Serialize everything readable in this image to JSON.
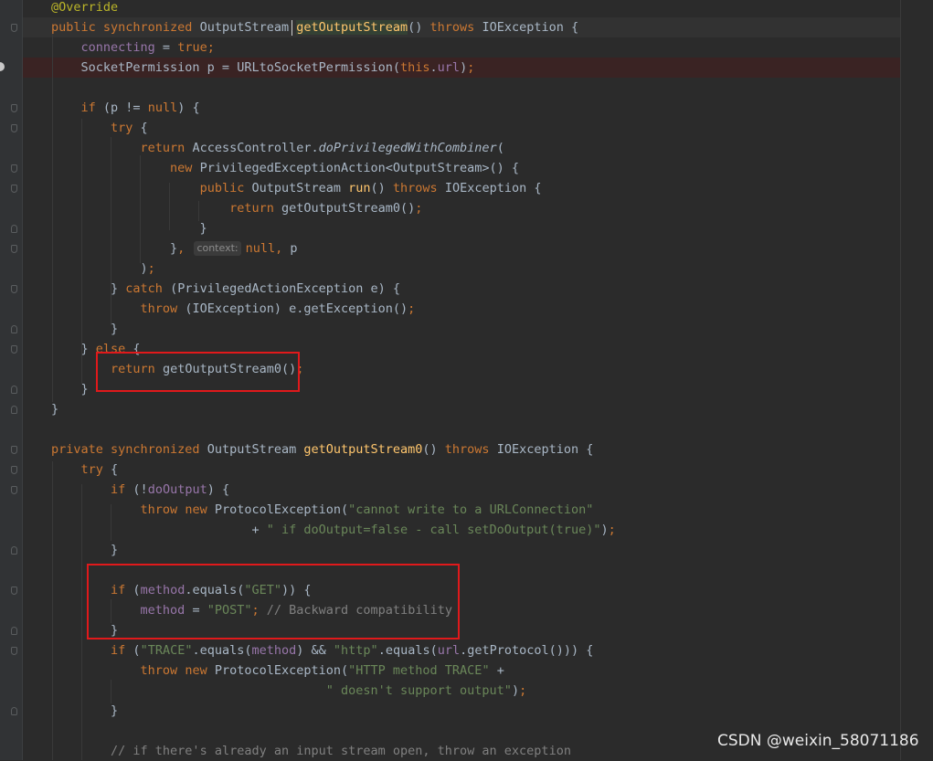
{
  "editor": {
    "theme_colors": {
      "background": "#2b2b2b",
      "keyword": "#cc7832",
      "annotation": "#bbb529",
      "field": "#9876aa",
      "string": "#6a8759",
      "comment": "#808080",
      "method_declaration": "#ffc66d",
      "highlight_box": "#e0191b"
    },
    "lines": [
      {
        "tokens": [
          {
            "t": "ann",
            "v": "@Override"
          }
        ]
      },
      {
        "tokens": [
          {
            "t": "kw",
            "v": "public synchronized "
          },
          {
            "t": "plain",
            "v": "OutputStream "
          },
          {
            "t": "sel",
            "v": "getOutputStream"
          },
          {
            "t": "plain",
            "v": "() "
          },
          {
            "t": "kw",
            "v": "throws "
          },
          {
            "t": "plain",
            "v": "IOException {"
          }
        ]
      },
      {
        "tokens": [
          {
            "t": "plain",
            "v": "    "
          },
          {
            "t": "field",
            "v": "connecting"
          },
          {
            "t": "plain",
            "v": " = "
          },
          {
            "t": "kw",
            "v": "true;"
          }
        ]
      },
      {
        "tokens": [
          {
            "t": "plain",
            "v": "    SocketPermission p = URLtoSocketPermission("
          },
          {
            "t": "kw",
            "v": "this"
          },
          {
            "t": "plain",
            "v": "."
          },
          {
            "t": "field",
            "v": "url"
          },
          {
            "t": "plain",
            "v": ")"
          },
          {
            "t": "kw",
            "v": ";"
          }
        ]
      },
      {
        "tokens": []
      },
      {
        "tokens": [
          {
            "t": "plain",
            "v": "    "
          },
          {
            "t": "kw",
            "v": "if "
          },
          {
            "t": "plain",
            "v": "(p != "
          },
          {
            "t": "kw",
            "v": "null"
          },
          {
            "t": "plain",
            "v": ") {"
          }
        ]
      },
      {
        "tokens": [
          {
            "t": "plain",
            "v": "        "
          },
          {
            "t": "kw",
            "v": "try "
          },
          {
            "t": "plain",
            "v": "{"
          }
        ]
      },
      {
        "tokens": [
          {
            "t": "plain",
            "v": "            "
          },
          {
            "t": "kw",
            "v": "return "
          },
          {
            "t": "plain",
            "v": "AccessController."
          },
          {
            "t": "ital",
            "v": "doPrivilegedWithCombiner"
          },
          {
            "t": "plain",
            "v": "("
          }
        ]
      },
      {
        "tokens": [
          {
            "t": "plain",
            "v": "                "
          },
          {
            "t": "kw",
            "v": "new "
          },
          {
            "t": "plain",
            "v": "PrivilegedExceptionAction<OutputStream>() {"
          }
        ]
      },
      {
        "tokens": [
          {
            "t": "plain",
            "v": "                    "
          },
          {
            "t": "kw",
            "v": "public "
          },
          {
            "t": "plain",
            "v": "OutputStream "
          },
          {
            "t": "method",
            "v": "run"
          },
          {
            "t": "plain",
            "v": "() "
          },
          {
            "t": "kw",
            "v": "throws "
          },
          {
            "t": "plain",
            "v": "IOException {"
          }
        ]
      },
      {
        "tokens": [
          {
            "t": "plain",
            "v": "                        "
          },
          {
            "t": "kw",
            "v": "return "
          },
          {
            "t": "plain",
            "v": "getOutputStream0()"
          },
          {
            "t": "kw",
            "v": ";"
          }
        ]
      },
      {
        "tokens": [
          {
            "t": "plain",
            "v": "                    }"
          }
        ]
      },
      {
        "tokens": [
          {
            "t": "plain",
            "v": "                }"
          },
          {
            "t": "kw",
            "v": ", "
          },
          {
            "t": "hint",
            "v": "context:"
          },
          {
            "t": "kw",
            "v": "null, "
          },
          {
            "t": "plain",
            "v": "p"
          }
        ]
      },
      {
        "tokens": [
          {
            "t": "plain",
            "v": "            )"
          },
          {
            "t": "kw",
            "v": ";"
          }
        ]
      },
      {
        "tokens": [
          {
            "t": "plain",
            "v": "        } "
          },
          {
            "t": "kw",
            "v": "catch "
          },
          {
            "t": "plain",
            "v": "(PrivilegedActionException e) {"
          }
        ]
      },
      {
        "tokens": [
          {
            "t": "plain",
            "v": "            "
          },
          {
            "t": "kw",
            "v": "throw "
          },
          {
            "t": "plain",
            "v": "(IOException) e.getException()"
          },
          {
            "t": "kw",
            "v": ";"
          }
        ]
      },
      {
        "tokens": [
          {
            "t": "plain",
            "v": "        }"
          }
        ]
      },
      {
        "tokens": [
          {
            "t": "plain",
            "v": "    } "
          },
          {
            "t": "kw",
            "v": "else "
          },
          {
            "t": "plain",
            "v": "{"
          }
        ]
      },
      {
        "tokens": [
          {
            "t": "plain",
            "v": "        "
          },
          {
            "t": "kw",
            "v": "return "
          },
          {
            "t": "plain",
            "v": "getOutputStream0()"
          },
          {
            "t": "kw",
            "v": ";"
          }
        ]
      },
      {
        "tokens": [
          {
            "t": "plain",
            "v": "    }"
          }
        ]
      },
      {
        "tokens": [
          {
            "t": "plain",
            "v": "}"
          }
        ]
      },
      {
        "tokens": []
      },
      {
        "tokens": [
          {
            "t": "kw",
            "v": "private synchronized "
          },
          {
            "t": "plain",
            "v": "OutputStream "
          },
          {
            "t": "method",
            "v": "getOutputStream0"
          },
          {
            "t": "plain",
            "v": "() "
          },
          {
            "t": "kw",
            "v": "throws "
          },
          {
            "t": "plain",
            "v": "IOException {"
          }
        ]
      },
      {
        "tokens": [
          {
            "t": "plain",
            "v": "    "
          },
          {
            "t": "kw",
            "v": "try "
          },
          {
            "t": "plain",
            "v": "{"
          }
        ]
      },
      {
        "tokens": [
          {
            "t": "plain",
            "v": "        "
          },
          {
            "t": "kw",
            "v": "if "
          },
          {
            "t": "plain",
            "v": "(!"
          },
          {
            "t": "field",
            "v": "doOutput"
          },
          {
            "t": "plain",
            "v": ") {"
          }
        ]
      },
      {
        "tokens": [
          {
            "t": "plain",
            "v": "            "
          },
          {
            "t": "kw",
            "v": "throw new "
          },
          {
            "t": "plain",
            "v": "ProtocolException("
          },
          {
            "t": "str",
            "v": "\"cannot write to a URLConnection\""
          }
        ]
      },
      {
        "tokens": [
          {
            "t": "plain",
            "v": "                           + "
          },
          {
            "t": "str",
            "v": "\" if doOutput=false - call setDoOutput(true)\""
          },
          {
            "t": "plain",
            "v": ")"
          },
          {
            "t": "kw",
            "v": ";"
          }
        ]
      },
      {
        "tokens": [
          {
            "t": "plain",
            "v": "        }"
          }
        ]
      },
      {
        "tokens": []
      },
      {
        "tokens": [
          {
            "t": "plain",
            "v": "        "
          },
          {
            "t": "kw",
            "v": "if "
          },
          {
            "t": "plain",
            "v": "("
          },
          {
            "t": "field",
            "v": "method"
          },
          {
            "t": "plain",
            "v": ".equals("
          },
          {
            "t": "str",
            "v": "\"GET\""
          },
          {
            "t": "plain",
            "v": ")) {"
          }
        ]
      },
      {
        "tokens": [
          {
            "t": "plain",
            "v": "            "
          },
          {
            "t": "field",
            "v": "method"
          },
          {
            "t": "plain",
            "v": " = "
          },
          {
            "t": "str",
            "v": "\"POST\""
          },
          {
            "t": "kw",
            "v": "; "
          },
          {
            "t": "comment",
            "v": "// Backward compatibility"
          }
        ]
      },
      {
        "tokens": [
          {
            "t": "plain",
            "v": "        }"
          }
        ]
      },
      {
        "tokens": [
          {
            "t": "plain",
            "v": "        "
          },
          {
            "t": "kw",
            "v": "if "
          },
          {
            "t": "plain",
            "v": "("
          },
          {
            "t": "str",
            "v": "\"TRACE\""
          },
          {
            "t": "plain",
            "v": ".equals("
          },
          {
            "t": "field",
            "v": "method"
          },
          {
            "t": "plain",
            "v": ") && "
          },
          {
            "t": "str",
            "v": "\"http\""
          },
          {
            "t": "plain",
            "v": ".equals("
          },
          {
            "t": "field",
            "v": "url"
          },
          {
            "t": "plain",
            "v": ".getProtocol())) {"
          }
        ]
      },
      {
        "tokens": [
          {
            "t": "plain",
            "v": "            "
          },
          {
            "t": "kw",
            "v": "throw new "
          },
          {
            "t": "plain",
            "v": "ProtocolException("
          },
          {
            "t": "str",
            "v": "\"HTTP method TRACE\""
          },
          {
            "t": "plain",
            "v": " +"
          }
        ]
      },
      {
        "tokens": [
          {
            "t": "plain",
            "v": "                                     "
          },
          {
            "t": "str",
            "v": "\" doesn't support output\""
          },
          {
            "t": "plain",
            "v": ")"
          },
          {
            "t": "kw",
            "v": ";"
          }
        ]
      },
      {
        "tokens": [
          {
            "t": "plain",
            "v": "        }"
          }
        ]
      },
      {
        "tokens": []
      },
      {
        "tokens": [
          {
            "t": "plain",
            "v": "        "
          },
          {
            "t": "comment",
            "v": "// if there's already an input stream open, throw an exception"
          }
        ]
      }
    ]
  },
  "watermark": {
    "text": "CSDN @weixin_58071186"
  }
}
